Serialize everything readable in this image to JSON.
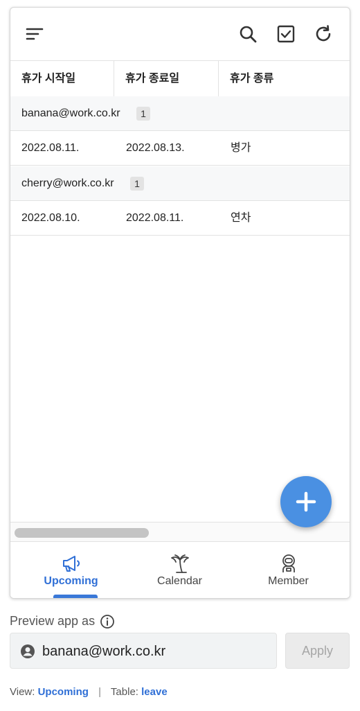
{
  "toolbar": {
    "menu_icon": "sort-lines-icon",
    "search_icon": "search-icon",
    "select_icon": "checkbox-icon",
    "refresh_icon": "refresh-icon"
  },
  "table": {
    "columns": [
      "휴가 시작일",
      "휴가 종료일",
      "휴가 종류"
    ],
    "groups": [
      {
        "label": "banana@work.co.kr",
        "count": "1",
        "rows": [
          [
            "2022.08.11.",
            "2022.08.13.",
            "병가"
          ]
        ]
      },
      {
        "label": "cherry@work.co.kr",
        "count": "1",
        "rows": [
          [
            "2022.08.10.",
            "2022.08.11.",
            "연차"
          ]
        ]
      }
    ]
  },
  "fab": {
    "icon": "plus-icon"
  },
  "nav": {
    "items": [
      {
        "label": "Upcoming",
        "icon": "megaphone-icon",
        "active": true
      },
      {
        "label": "Calendar",
        "icon": "palm-tree-icon",
        "active": false
      },
      {
        "label": "Member",
        "icon": "astronaut-icon",
        "active": false
      }
    ]
  },
  "preview": {
    "label": "Preview app as",
    "user": "banana@work.co.kr",
    "apply_label": "Apply"
  },
  "footer": {
    "view_label": "View:",
    "view_value": "Upcoming",
    "separator": "|",
    "table_label": "Table:",
    "table_value": "leave"
  },
  "colors": {
    "accent": "#2f6fd6",
    "fab": "#4a90e2",
    "group_bg": "#f7f8f9"
  }
}
